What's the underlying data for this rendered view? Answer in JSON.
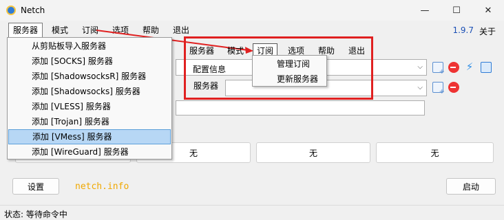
{
  "window": {
    "title": "Netch",
    "min_icon": "minimize-icon",
    "max_icon": "maximize-icon",
    "close_icon": "close-icon"
  },
  "menubar": {
    "items": [
      "服务器",
      "模式",
      "订阅",
      "选项",
      "帮助",
      "退出"
    ],
    "version": "1.9.7",
    "about": "关于"
  },
  "server_menu": {
    "items": [
      "从剪贴板导入服务器",
      "添加 [SOCKS] 服务器",
      "添加 [ShadowsocksR] 服务器",
      "添加 [Shadowsocks] 服务器",
      "添加 [VLESS] 服务器",
      "添加 [Trojan] 服务器",
      "添加 [VMess] 服务器",
      "添加 [WireGuard] 服务器"
    ],
    "highlighted_index": 6
  },
  "config": {
    "group_label": "配置信息",
    "server_label": "服务器"
  },
  "inset": {
    "menu_items": [
      "服务器",
      "模式",
      "订阅",
      "选项",
      "帮助",
      "退出"
    ],
    "open_index": 2,
    "submenu": [
      "管理订阅",
      "更新服务器"
    ]
  },
  "status_buttons": [
    "无",
    "无",
    "无"
  ],
  "buttons": {
    "settings": "设置",
    "start": "启动"
  },
  "site": "netch.info",
  "status": "状态: 等待命令中",
  "colors": {
    "version": "#1a4fb5",
    "site": "#f0a800",
    "highlight": "#b7d7f5",
    "annotation": "#e02020"
  }
}
